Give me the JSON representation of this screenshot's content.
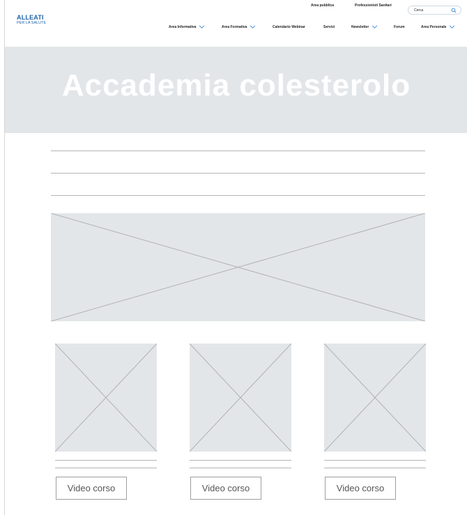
{
  "header": {
    "logo_title": "ALLEATI",
    "logo_subtitle": "PER LA SALUTE",
    "top_links": [
      "Area pubblica",
      "Professionisti Sanitari"
    ],
    "search_placeholder": "Cerca",
    "nav": [
      {
        "label": "Area Informativa",
        "has_dropdown": true
      },
      {
        "label": "Area Formativa",
        "has_dropdown": true
      },
      {
        "label": "Calendario Webinar",
        "has_dropdown": false
      },
      {
        "label": "Servizi",
        "has_dropdown": false
      },
      {
        "label": "Newsletter",
        "has_dropdown": true
      },
      {
        "label": "Forum",
        "has_dropdown": false
      },
      {
        "label": "Area Personale",
        "has_dropdown": true
      }
    ]
  },
  "hero": {
    "title": "Accademia colesterolo"
  },
  "courses": [
    {
      "button_label": "Video corso"
    },
    {
      "button_label": "Video corso"
    },
    {
      "button_label": "Video corso"
    }
  ],
  "colors": {
    "brand": "#1f64a8",
    "placeholder": "#e3e6e9",
    "chevron": "#2f7fd0"
  }
}
